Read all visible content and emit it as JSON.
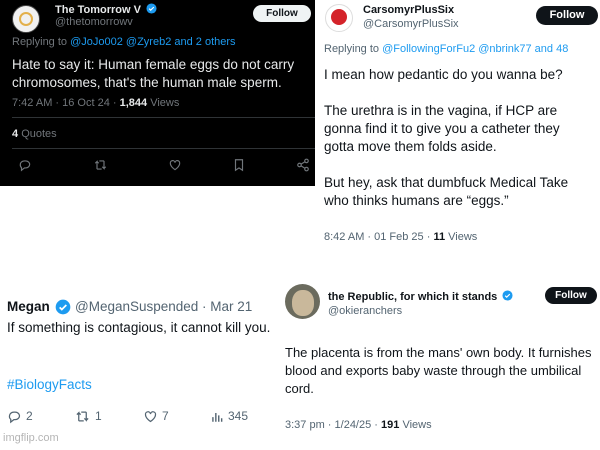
{
  "tweet1": {
    "name": "The Tomorrow V",
    "handle": "@thetomorrowv",
    "follow_label": "Follow",
    "replying_prefix": "Replying to",
    "replying_to": "@JoJo002 @Zyreb2 and 2 others",
    "text": "Hate to say it: Human female eggs do not carry chromosomes, that's the human male sperm.",
    "timestamp": "7:42 AM · 16 Oct 24 ·",
    "views_count": "1,844",
    "views_label": "Views",
    "quotes_count": "4",
    "quotes_label": "Quotes",
    "actions": [
      "reply-icon",
      "retweet-icon",
      "like-icon",
      "bookmark-icon",
      "share-icon"
    ]
  },
  "tweet2": {
    "name": "CarsomyrPlusSix",
    "handle": "@CarsomyrPlusSix",
    "follow_label": "Follow",
    "replying_prefix": "Replying to",
    "replying_to": "@FollowingForFu2 @nbrink77 and 48",
    "text": "I mean how pedantic do you wanna be?\n\nThe urethra is in the vagina, if HCP are\ngonna find it to give you a catheter they\ngotta move them folds aside.\n\nBut hey, ask that dumbfuck Medical Take\nwho thinks humans are “eggs.”",
    "timestamp": "8:42 AM · 01 Feb 25 ·",
    "views_count": "11",
    "views_label": "Views"
  },
  "tweet3": {
    "name": "Megan",
    "handle": "@MeganSuspended · Mar 21",
    "text": "If something is contagious, it cannot kill you.",
    "hashtag": "#BiologyFacts",
    "replies": "2",
    "retweets": "1",
    "likes": "7",
    "views": "345",
    "watermark": "imgflip.com"
  },
  "tweet4": {
    "name": "the Republic, for which it stands",
    "handle": "@okieranchers",
    "follow_label": "Follow",
    "text": "The placenta is from the mans' own body. It furnishes blood and exports baby waste through the umbilical cord.",
    "timestamp": "3:37 pm · 1/24/25 ·",
    "views_count": "191",
    "views_label": "Views"
  },
  "colors": {
    "accent": "#1d9bf0",
    "dark_bg": "#000000",
    "muted_dark": "#71767b",
    "muted_light": "#536471"
  }
}
